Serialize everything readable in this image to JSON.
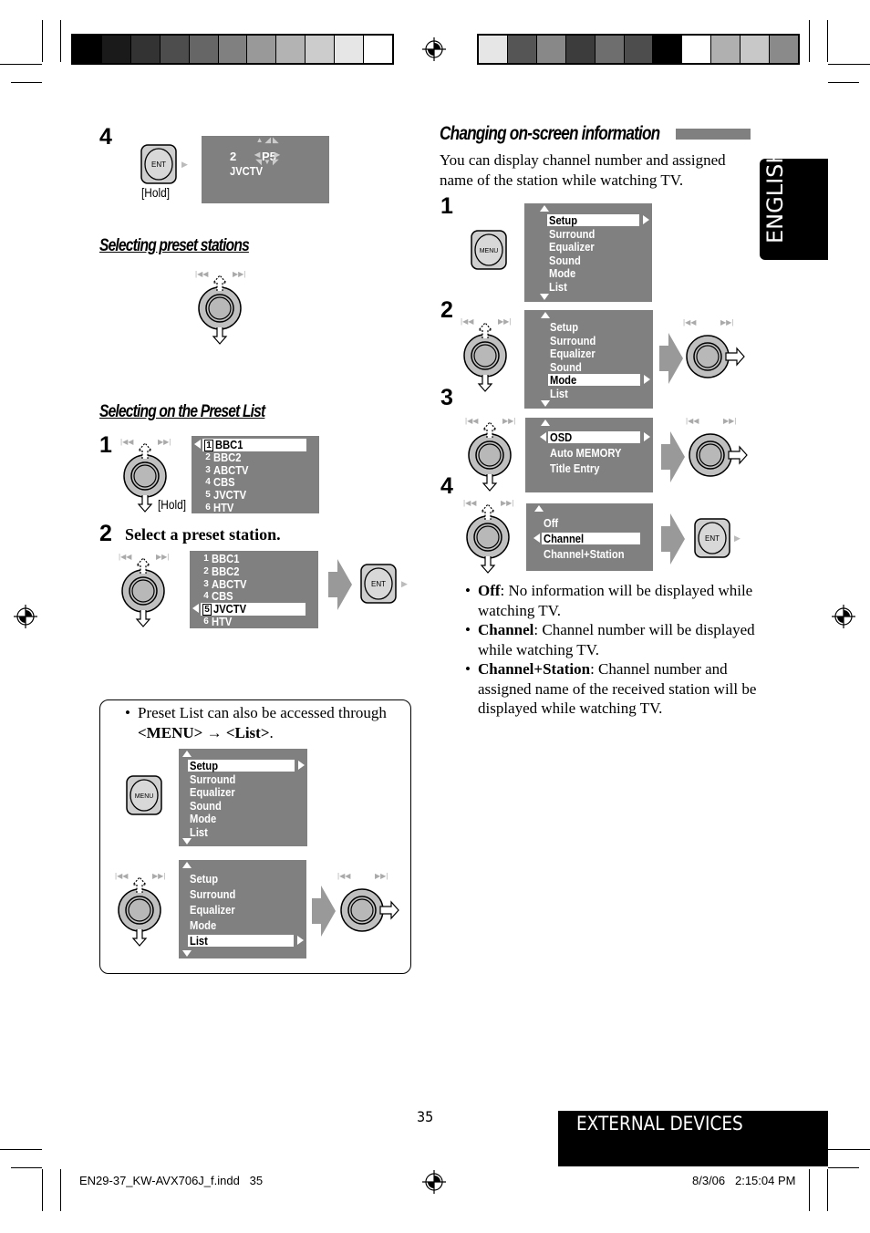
{
  "colorbars": {
    "left": [
      "#000000",
      "#1a1a1a",
      "#333333",
      "#4d4d4d",
      "#666666",
      "#808080",
      "#999999",
      "#b3b3b3",
      "#cccccc",
      "#e6e6e6",
      "#ffffff"
    ],
    "right": [
      "#e6e6e6",
      "#555555",
      "#888888",
      "#3c3c3c",
      "#6e6e6e",
      "#4d4d4d",
      "#000000",
      "#ffffff",
      "#b0b0b0",
      "#c8c8c8",
      "#8a8a8a"
    ]
  },
  "left": {
    "step4": {
      "num": "4",
      "ent": "ENT",
      "hold": "[Hold]",
      "display": {
        "channel": "2",
        "preset": "P5",
        "name": "JVCTV"
      }
    },
    "heading_preset_stations": "Selecting preset stations",
    "heading_preset_list": "Selecting on  the Preset List",
    "list_step1": {
      "num": "1",
      "hold": "[Hold]",
      "selected": 0,
      "items": [
        {
          "n": "1",
          "name": "BBC1"
        },
        {
          "n": "2",
          "name": "BBC2"
        },
        {
          "n": "3",
          "name": "ABCTV"
        },
        {
          "n": "4",
          "name": "CBS"
        },
        {
          "n": "5",
          "name": "JVCTV"
        },
        {
          "n": "6",
          "name": "HTV"
        }
      ]
    },
    "list_step2": {
      "num": "2",
      "text": "Select a preset station.",
      "ent": "ENT",
      "selected": 4,
      "items": [
        {
          "n": "1",
          "name": "BBC1"
        },
        {
          "n": "2",
          "name": "BBC2"
        },
        {
          "n": "3",
          "name": "ABCTV"
        },
        {
          "n": "4",
          "name": "CBS"
        },
        {
          "n": "5",
          "name": "JVCTV"
        },
        {
          "n": "6",
          "name": "HTV"
        }
      ]
    },
    "note": {
      "line1": "Preset List can also be accessed through",
      "menu": "<MENU>",
      "arrow": "→",
      "list": "<List>",
      "end": ".",
      "menu_button": "MENU",
      "panel1": {
        "selected": 0,
        "items": [
          "Setup",
          "Surround",
          "Equalizer",
          "Sound",
          "Mode",
          "List"
        ]
      },
      "panel2": {
        "selected": 4,
        "items": [
          "Setup",
          "Surround",
          "Equalizer",
          "Mode",
          "List"
        ]
      }
    }
  },
  "right": {
    "heading": "Changing on-screen information",
    "intro": "You can display channel number and assigned name of the station while watching TV.",
    "steps": [
      "1",
      "2",
      "3",
      "4"
    ],
    "menu_button": "MENU",
    "ent": "ENT",
    "panel1": {
      "selected": 0,
      "items": [
        "Setup",
        "Surround",
        "Equalizer",
        "Sound",
        "Mode",
        "List"
      ]
    },
    "panel2": {
      "selected": 4,
      "items": [
        "Setup",
        "Surround",
        "Equalizer",
        "Sound",
        "Mode",
        "List"
      ]
    },
    "panel3": {
      "selected": 0,
      "items": [
        "OSD",
        "Auto MEMORY",
        "Title Entry"
      ]
    },
    "panel4": {
      "selected": 1,
      "items": [
        "Off",
        "Channel",
        "Channel+Station"
      ]
    },
    "bullets": [
      {
        "term": "Off",
        "desc": ": No information will be displayed while watching TV."
      },
      {
        "term": "Channel",
        "desc": ": Channel number will be displayed while watching TV."
      },
      {
        "term": "Channel+Station",
        "desc": ": Channel number and assigned name of the received station will be displayed while watching TV."
      }
    ]
  },
  "tab": "ENGLISH",
  "page_number": "35",
  "section": "EXTERNAL DEVICES",
  "footer": {
    "file": "EN29-37_KW-AVX706J_f.indd   35",
    "date": "8/3/06   2:15:04 PM"
  }
}
